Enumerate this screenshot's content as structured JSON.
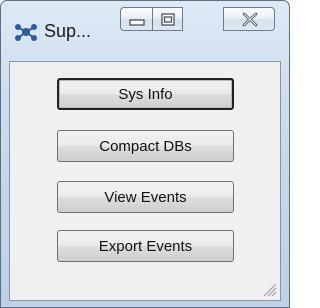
{
  "window": {
    "title": "Sup...",
    "app_icon": "network-icon",
    "caption_buttons": [
      "minimize-icon",
      "maximize-icon",
      "close-icon"
    ]
  },
  "buttons": [
    {
      "label": "Sys Info",
      "is_default": true
    },
    {
      "label": "Compact DBs",
      "is_default": false
    },
    {
      "label": "View Events",
      "is_default": false
    },
    {
      "label": "Export Events",
      "is_default": false
    }
  ],
  "colors": {
    "frame": "#c4d6ea",
    "client": "#f0f0f0",
    "button_text": "#111111"
  }
}
